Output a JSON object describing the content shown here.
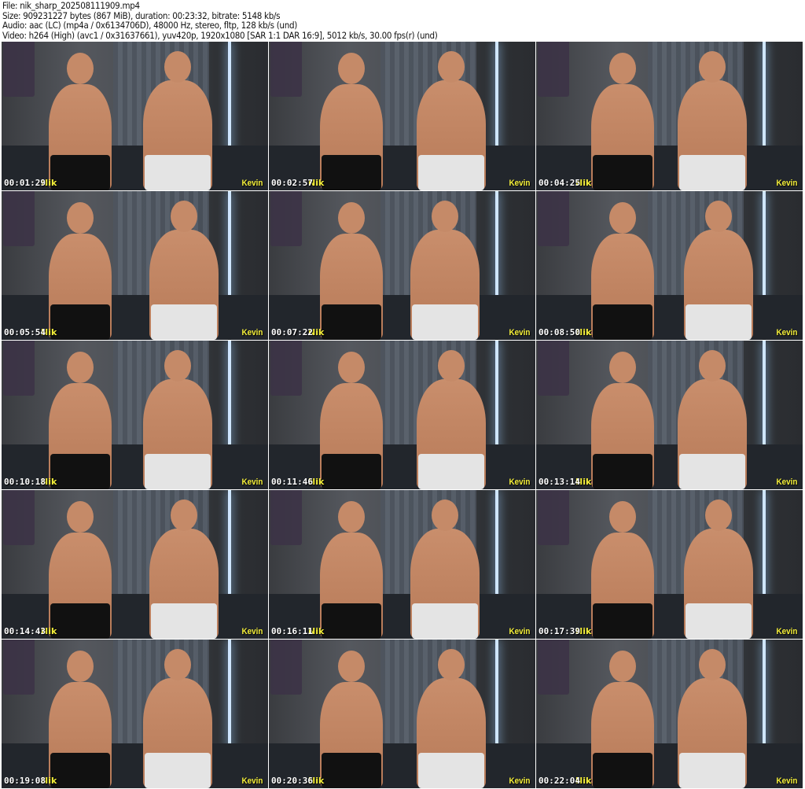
{
  "header": {
    "file": "File: nik_sharp_202508111909.mp4",
    "size": "Size: 909231227 bytes (867 MiB), duration: 00:23:32, bitrate: 5148 kb/s",
    "audio": "Audio: aac (LC) (mp4a / 0x6134706D), 48000 Hz, stereo, fltp, 128 kb/s (und)",
    "video": "Video: h264 (High) (avc1 / 0x31637661), yuv420p, 1920x1080 [SAR 1:1 DAR 16:9], 5012 kb/s, 30.00 fps(r) (und)"
  },
  "labels": {
    "left": "Nik",
    "right": "Kevin"
  },
  "thumbnails": [
    {
      "time": "00:01:29"
    },
    {
      "time": "00:02:57"
    },
    {
      "time": "00:04:25"
    },
    {
      "time": "00:05:54"
    },
    {
      "time": "00:07:22"
    },
    {
      "time": "00:08:50"
    },
    {
      "time": "00:10:18"
    },
    {
      "time": "00:11:46"
    },
    {
      "time": "00:13:14"
    },
    {
      "time": "00:14:43"
    },
    {
      "time": "00:16:11"
    },
    {
      "time": "00:17:39"
    },
    {
      "time": "00:19:08"
    },
    {
      "time": "00:20:36"
    },
    {
      "time": "00:22:04"
    }
  ]
}
